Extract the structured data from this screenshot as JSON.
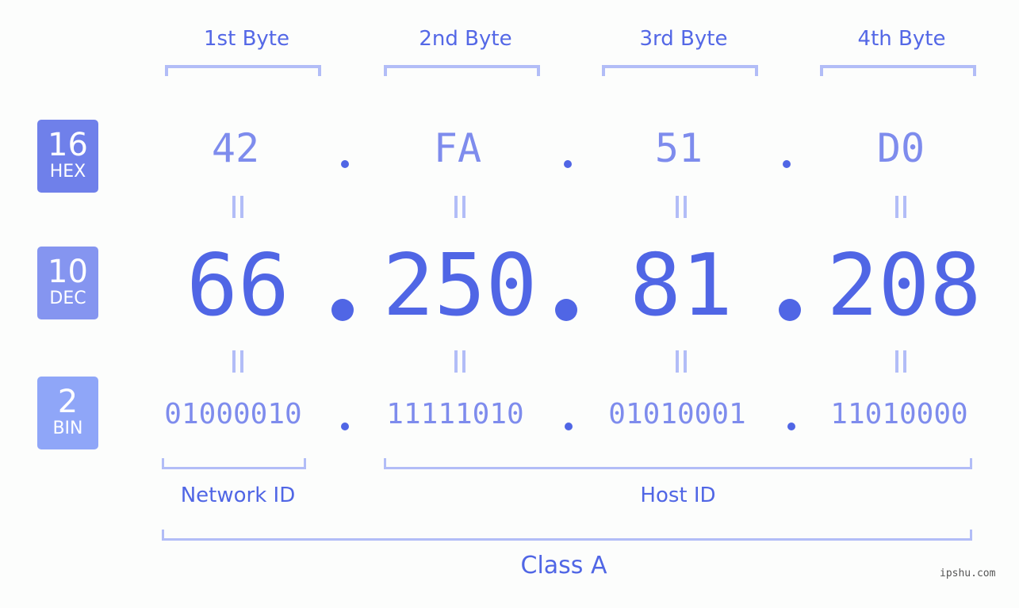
{
  "bases": [
    {
      "num": "16",
      "label": "HEX",
      "color": "#6f80ea"
    },
    {
      "num": "10",
      "label": "DEC",
      "color": "#8595f0"
    },
    {
      "num": "2",
      "label": "BIN",
      "color": "#8fa6f8"
    }
  ],
  "bytes": [
    {
      "label": "1st Byte",
      "hex": "42",
      "dec": "66",
      "bin": "01000010"
    },
    {
      "label": "2nd Byte",
      "hex": "FA",
      "dec": "250",
      "bin": "11111010"
    },
    {
      "label": "3rd Byte",
      "hex": "51",
      "dec": "81",
      "bin": "01010001"
    },
    {
      "label": "4th Byte",
      "hex": "D0",
      "dec": "208",
      "bin": "11010000"
    }
  ],
  "parts": {
    "network": "Network ID",
    "host": "Host ID",
    "class": "Class A"
  },
  "watermark": "ipshu.com"
}
